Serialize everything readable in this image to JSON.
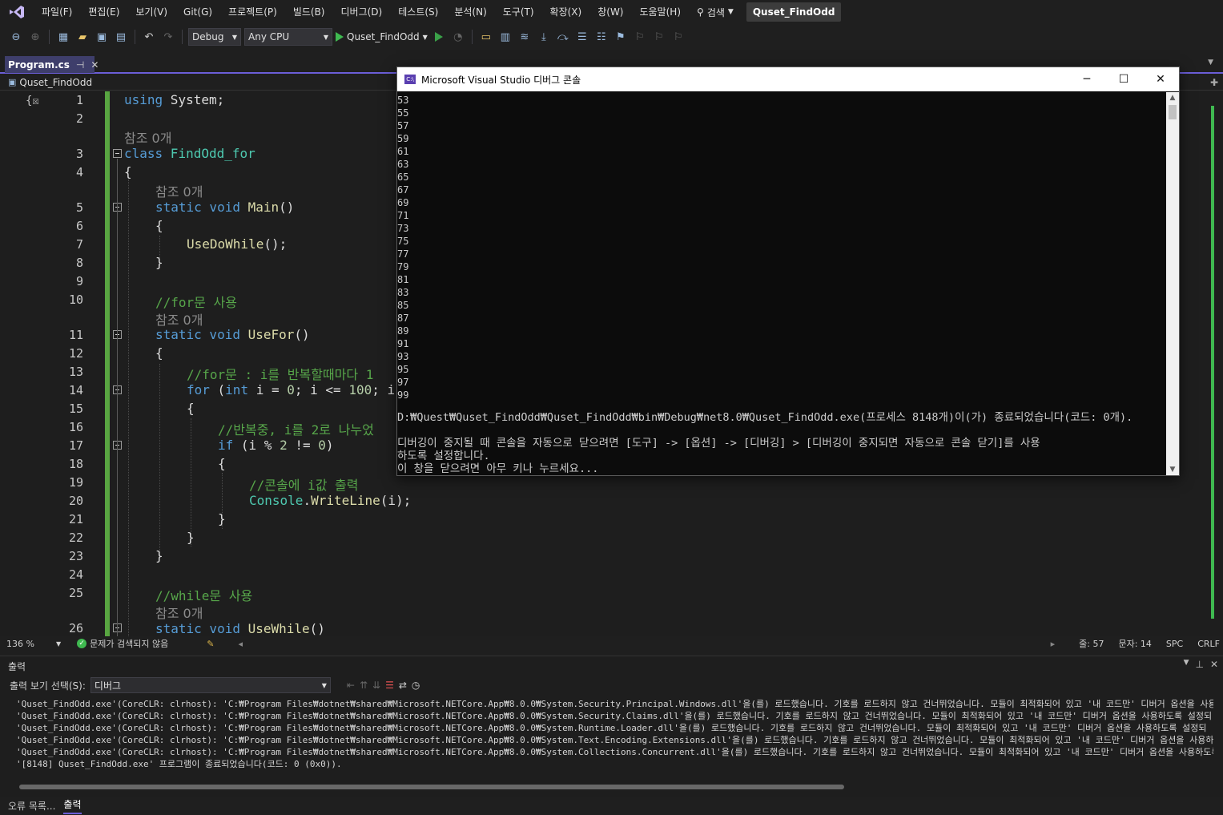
{
  "menu": [
    "파일(F)",
    "편집(E)",
    "보기(V)",
    "Git(G)",
    "프로젝트(P)",
    "빌드(B)",
    "디버그(D)",
    "테스트(S)",
    "분석(N)",
    "도구(T)",
    "확장(X)",
    "창(W)",
    "도움말(H)"
  ],
  "search_label": "검색",
  "solution_name": "Quset_FindOdd",
  "toolbar": {
    "config": "Debug",
    "platform": "Any CPU",
    "run_target": "Quset_FindOdd"
  },
  "tab": {
    "label": "Program.cs",
    "pin": "⊣",
    "close": "✕"
  },
  "nav": {
    "project": "Quset_FindOdd"
  },
  "editor": {
    "line_numbers": [
      "1",
      "2",
      "3",
      "4",
      "5",
      "6",
      "7",
      "8",
      "9",
      "10",
      "11",
      "12",
      "13",
      "14",
      "15",
      "16",
      "17",
      "18",
      "19",
      "20",
      "21",
      "22",
      "23",
      "24",
      "25",
      "26"
    ],
    "ref_lens": "참조 0개",
    "lines": {
      "l1a": "using",
      "l1b": " System;",
      "l3a": "class",
      "l3b": " FindOdd_for",
      "l4": "{",
      "l5a": "static void",
      "l5b": " Main",
      "l5c": "()",
      "l6": "{",
      "l7a": "UseDoWhile",
      "l7b": "();",
      "l8": "}",
      "l10": "//for문 사용",
      "l11a": "static void",
      "l11b": " UseFor",
      "l11c": "()",
      "l12": "{",
      "l13": "//for문 : i를 반복할때마다 1",
      "l14a": "for",
      "l14b": " (",
      "l14c": "int",
      "l14d": " i = ",
      "l14e": "0",
      "l14f": "; i <= ",
      "l14g": "100",
      "l14h": "; i",
      "l15": "{",
      "l16": "//반복중, i를 2로 나누었",
      "l17a": "if",
      "l17b": " (i % ",
      "l17c": "2",
      "l17d": " != ",
      "l17e": "0",
      "l17f": ")",
      "l18": "{",
      "l19": "//콘솔에 i값 출력",
      "l20a": "Console",
      "l20b": ".",
      "l20c": "WriteLine",
      "l20d": "(i);",
      "l21": "}",
      "l22": "}",
      "l23": "}",
      "l25": "//while문 사용",
      "l26a": "static void",
      "l26b": " UseWhile",
      "l26c": "()"
    }
  },
  "status": {
    "zoom": "136 %",
    "issues": "문제가 검색되지 않음",
    "line": "줄: 57",
    "col": "문자: 14",
    "spc": "SPC",
    "eol": "CRLF"
  },
  "output": {
    "title": "출력",
    "source_label": "출력 보기 선택(S):",
    "source_value": "디버그",
    "lines": [
      "'Quset_FindOdd.exe'(CoreCLR: clrhost): 'C:₩Program Files₩dotnet₩shared₩Microsoft.NETCore.App₩8.0.0₩System.Security.Principal.Windows.dll'을(를) 로드했습니다. 기호를 로드하지 않고 건너뛰었습니다. 모듈이 최적화되어 있고 '내 코드만' 디버거 옵션을 사용하도",
      "'Quset_FindOdd.exe'(CoreCLR: clrhost): 'C:₩Program Files₩dotnet₩shared₩Microsoft.NETCore.App₩8.0.0₩System.Security.Claims.dll'을(를) 로드했습니다. 기호를 로드하지 않고 건너뛰었습니다. 모듈이 최적화되어 있고 '내 코드만' 디버거 옵션을 사용하도록 설정되",
      "'Quset_FindOdd.exe'(CoreCLR: clrhost): 'C:₩Program Files₩dotnet₩shared₩Microsoft.NETCore.App₩8.0.0₩System.Runtime.Loader.dll'을(를) 로드했습니다. 기호를 로드하지 않고 건너뛰었습니다. 모듈이 최적화되어 있고 '내 코드만' 디버거 옵션을 사용하도록 설정되",
      "'Quset_FindOdd.exe'(CoreCLR: clrhost): 'C:₩Program Files₩dotnet₩shared₩Microsoft.NETCore.App₩8.0.0₩System.Text.Encoding.Extensions.dll'을(를) 로드했습니다. 기호를 로드하지 않고 건너뛰었습니다. 모듈이 최적화되어 있고 '내 코드만' 디버거 옵션을 사용하도",
      "'Quset_FindOdd.exe'(CoreCLR: clrhost): 'C:₩Program Files₩dotnet₩shared₩Microsoft.NETCore.App₩8.0.0₩System.Collections.Concurrent.dll'을(를) 로드했습니다. 기호를 로드하지 않고 건너뛰었습니다. 모듈이 최적화되어 있고 '내 코드만' 디버거 옵션을 사용하도록",
      "'[8148] Quset_FindOdd.exe' 프로그램이 종료되었습니다(코드: 0 (0x0))."
    ]
  },
  "bottom_tabs": [
    "오류 목록...",
    "출력"
  ],
  "console": {
    "title": "Microsoft Visual Studio 디버그 콘솔",
    "numbers": [
      "53",
      "55",
      "57",
      "59",
      "61",
      "63",
      "65",
      "67",
      "69",
      "71",
      "73",
      "75",
      "77",
      "79",
      "81",
      "83",
      "85",
      "87",
      "89",
      "91",
      "93",
      "95",
      "97",
      "99"
    ],
    "exit_line": "D:₩Quest₩Quset_FindOdd₩Quset_FindOdd₩bin₩Debug₩net8.0₩Quset_FindOdd.exe(프로세스 8148개)이(가) 종료되었습니다(코드: 0개).",
    "msg1": "디버깅이 중지될 때 콘솔을 자동으로 닫으려면 [도구] -> [옵션] -> [디버깅] > [디버깅이 중지되면 자동으로 콘솔 닫기]를 사용",
    "msg2": "하도록 설정합니다.",
    "msg3": "이 창을 닫으려면 아무 키나 누르세요..."
  }
}
